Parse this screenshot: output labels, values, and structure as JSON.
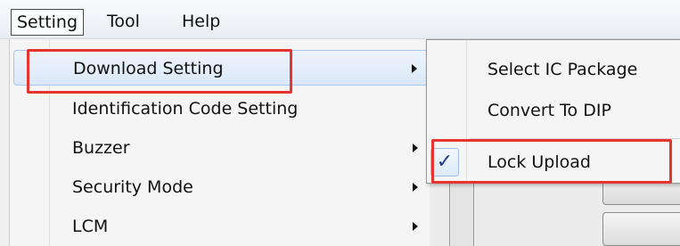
{
  "menubar": {
    "items": [
      "Setting",
      "Tool",
      "Help"
    ]
  },
  "dropdown": {
    "items": [
      {
        "label": "Download Setting",
        "has_submenu": true
      },
      {
        "label": "Identification Code Setting",
        "has_submenu": false
      },
      {
        "label": "Buzzer",
        "has_submenu": true
      },
      {
        "label": "Security Mode",
        "has_submenu": true
      },
      {
        "label": "LCM",
        "has_submenu": true
      }
    ]
  },
  "submenu": {
    "items": [
      {
        "label": "Select IC Package",
        "checked": false
      },
      {
        "label": "Convert To DIP",
        "checked": false
      },
      {
        "label": "Lock Upload",
        "checked": true
      }
    ],
    "check_glyph": "✓"
  },
  "colors": {
    "highlight": "#e8342f",
    "check": "#1f3c8e",
    "hover_border": "#a9c6ee"
  }
}
